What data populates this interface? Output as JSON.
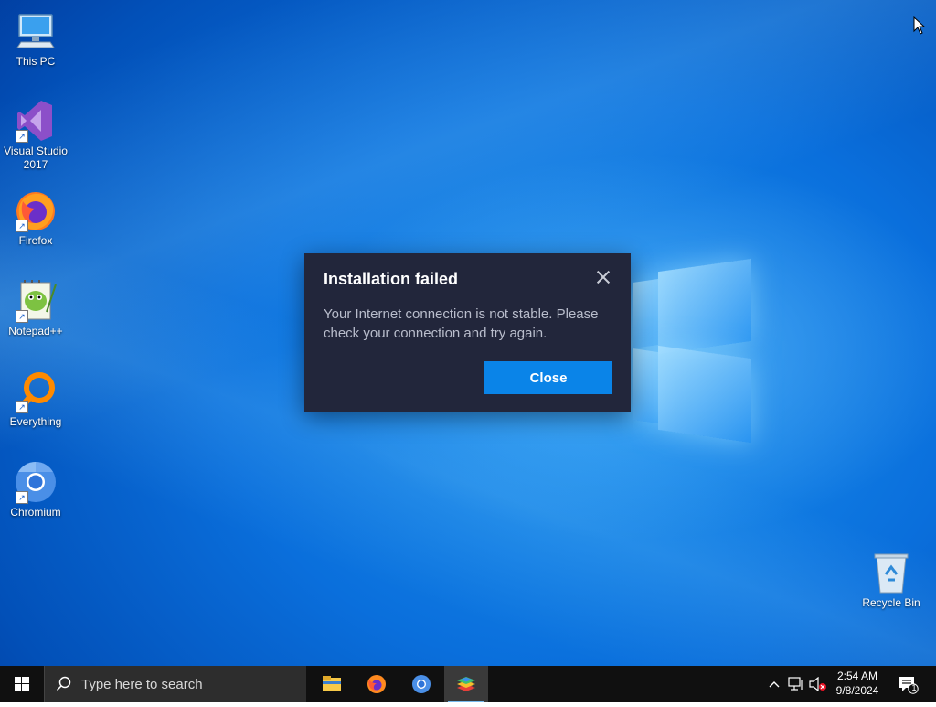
{
  "desktop": {
    "icons": [
      {
        "label": "This PC",
        "icon": "computer-icon"
      },
      {
        "label": "Visual Studio 2017",
        "icon": "visual-studio-icon"
      },
      {
        "label": "Firefox",
        "icon": "firefox-icon"
      },
      {
        "label": "Notepad++",
        "icon": "notepad-plus-plus-icon"
      },
      {
        "label": "Everything",
        "icon": "everything-search-icon"
      },
      {
        "label": "Chromium",
        "icon": "chromium-icon"
      },
      {
        "label": "Recycle Bin",
        "icon": "recycle-bin-icon"
      }
    ]
  },
  "dialog": {
    "title": "Installation failed",
    "message": "Your Internet connection is not stable. Please check your connection and try again.",
    "close_button": "Close",
    "background_color": "#22263b",
    "button_color": "#0a84e8"
  },
  "taskbar": {
    "search_placeholder": "Type here to search",
    "apps": [
      {
        "name": "File Explorer",
        "icon": "file-explorer-icon"
      },
      {
        "name": "Firefox",
        "icon": "firefox-icon"
      },
      {
        "name": "Chromium",
        "icon": "chromium-icon"
      },
      {
        "name": "BlueStacks",
        "icon": "bluestacks-icon",
        "active": true
      }
    ],
    "tray": {
      "icons": [
        "chevron-up-icon",
        "network-icon",
        "volume-muted-icon"
      ],
      "time": "2:54 AM",
      "date": "9/8/2024",
      "notification_count": "1"
    }
  }
}
